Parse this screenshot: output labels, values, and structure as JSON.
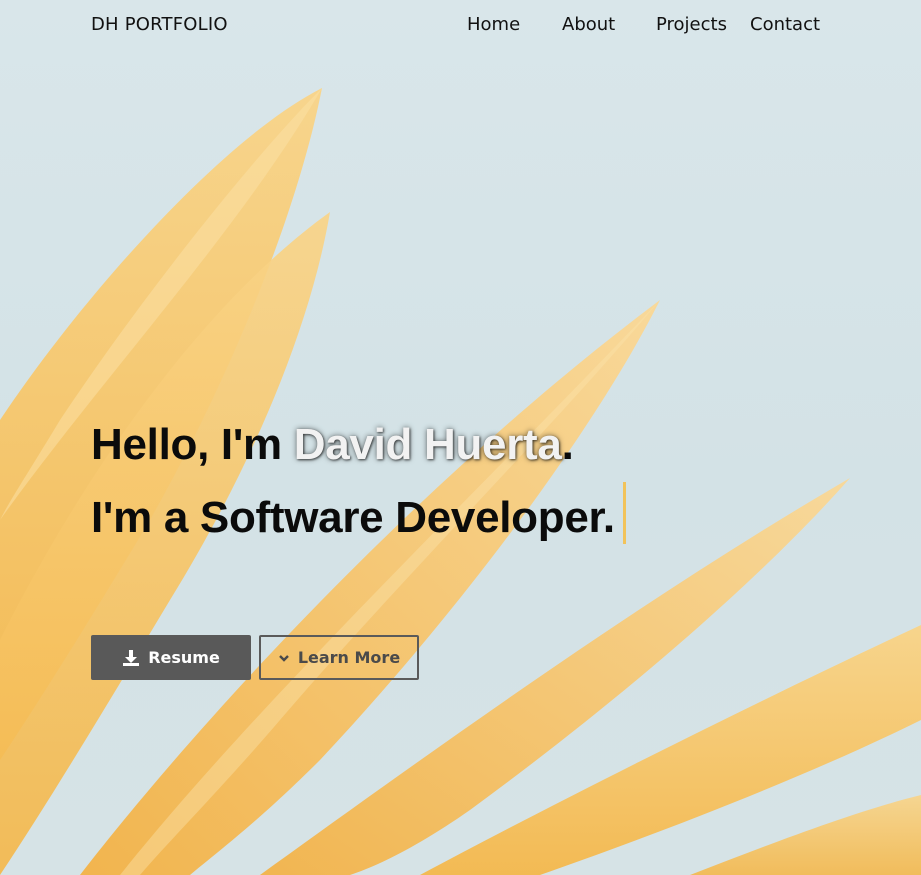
{
  "nav": {
    "brand": "DH PORTFOLIO",
    "links": [
      {
        "label": "Home"
      },
      {
        "label": "About"
      },
      {
        "label": "Projects"
      },
      {
        "label": "Contact"
      }
    ]
  },
  "hero": {
    "greeting_prefix": "Hello, I'm ",
    "name": "David Huerta",
    "greeting_suffix": ".",
    "tagline": "I'm a Software Developer.",
    "background": "yellow flower petals on pale blue sky",
    "accent_color": "#f2c35a"
  },
  "buttons": {
    "resume": {
      "label": "Resume",
      "icon": "download-icon"
    },
    "learn_more": {
      "label": "Learn More",
      "icon": "chevron-down-icon"
    }
  }
}
